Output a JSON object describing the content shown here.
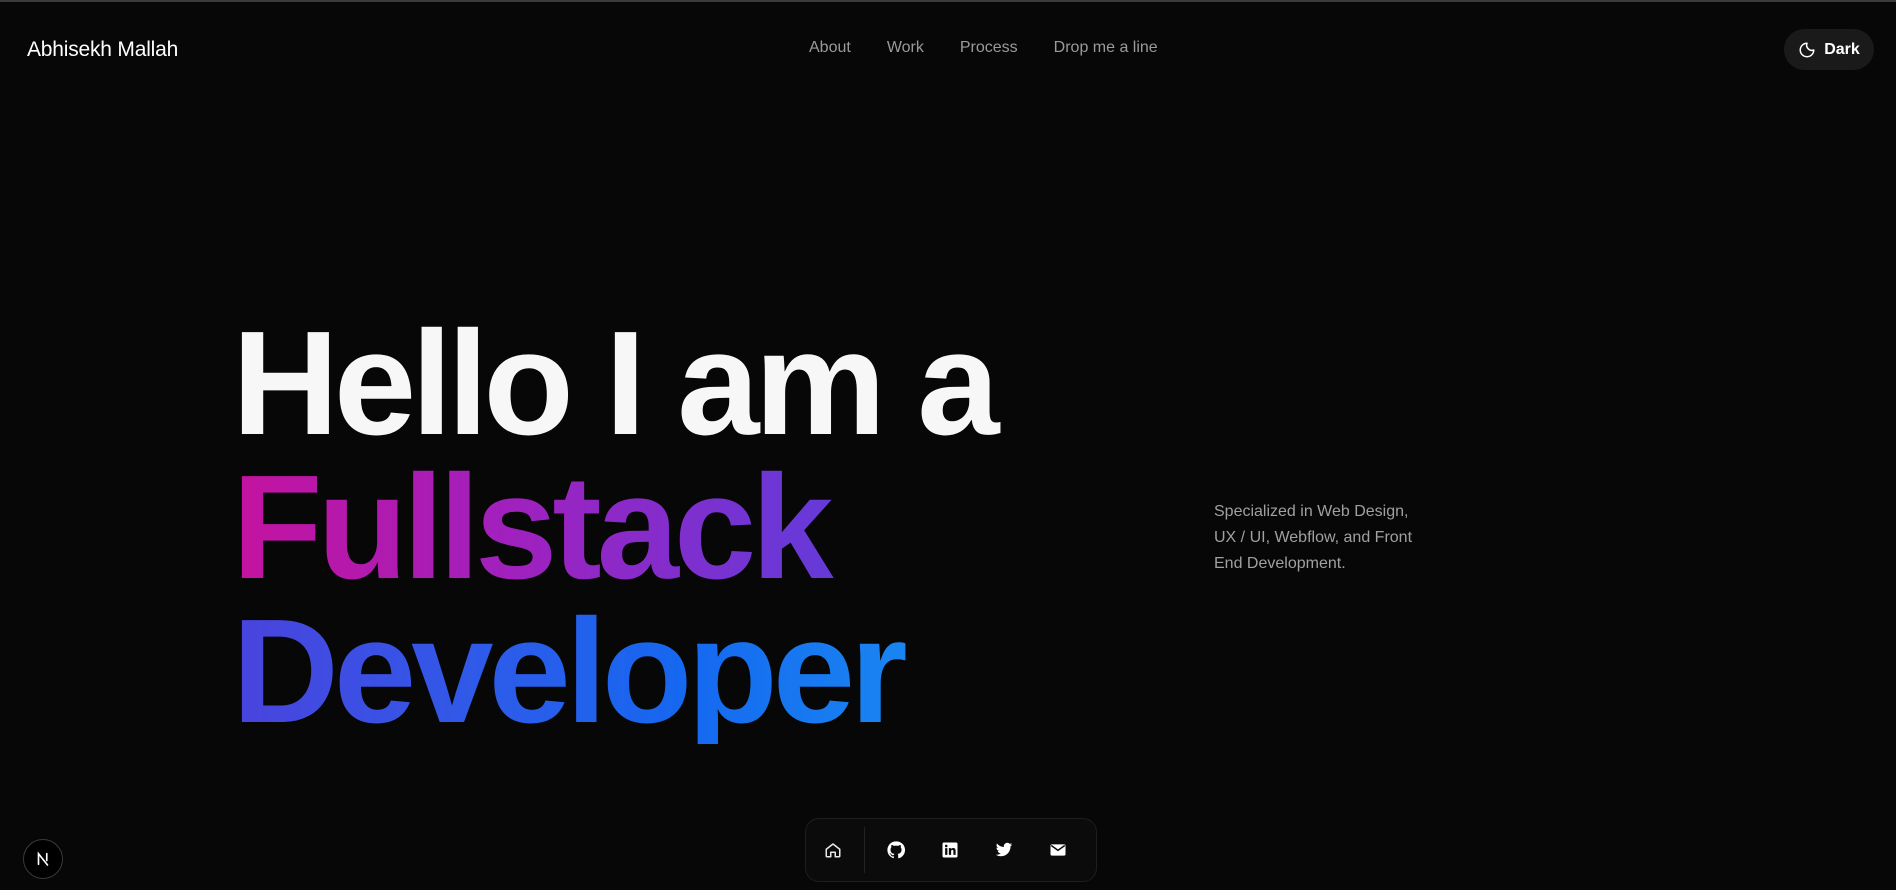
{
  "header": {
    "brand": "Abhisekh Mallah",
    "nav": [
      {
        "label": "About"
      },
      {
        "label": "Work"
      },
      {
        "label": "Process"
      },
      {
        "label": "Drop me a line"
      }
    ],
    "theme_toggle": {
      "label": "Dark",
      "icon": "moon-icon"
    }
  },
  "hero": {
    "line1": "Hello I am a",
    "line2": "Fullstack",
    "line3": "Developer",
    "gradient_colors": [
      "#c4139f",
      "#6c37d6",
      "#1568f0",
      "#1a89f1"
    ]
  },
  "tagline": "Specialized in Web Design, UX / UI, Webflow, and Front End Development.",
  "dock": {
    "items": [
      {
        "icon": "home-icon"
      },
      {
        "icon": "github-icon"
      },
      {
        "icon": "linkedin-icon"
      },
      {
        "icon": "twitter-icon"
      },
      {
        "icon": "mail-icon"
      }
    ]
  },
  "badge": {
    "icon": "nextjs-icon"
  }
}
